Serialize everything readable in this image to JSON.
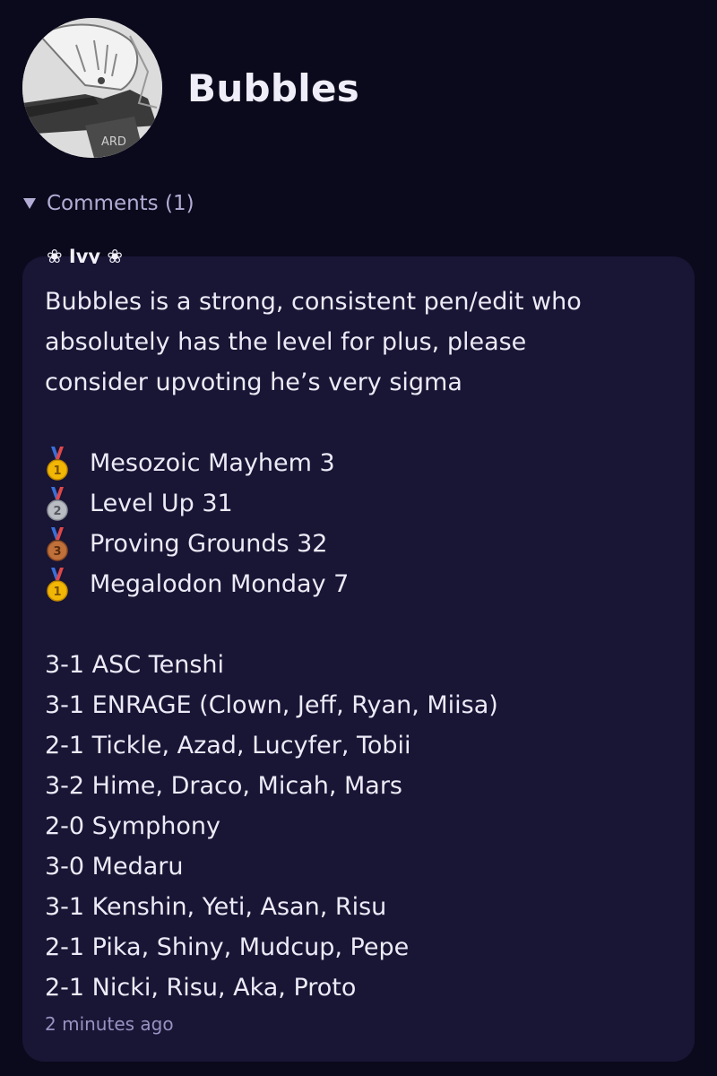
{
  "profile": {
    "username": "Bubbles",
    "avatar_text": "ARD"
  },
  "comments": {
    "toggle_label": "Comments (1)",
    "items": [
      {
        "author": "❀ Ivy ❀",
        "intro_lines": [
          "Bubbles is a strong, consistent pen/edit who",
          "absolutely has the level for plus, please",
          "consider upvoting he’s very sigma"
        ],
        "placements": [
          {
            "medal": "gold-medal-icon",
            "place": "1",
            "event": "Mesozoic Mayhem 3"
          },
          {
            "medal": "silver-medal-icon",
            "place": "2",
            "event": "Level Up 31"
          },
          {
            "medal": "bronze-medal-icon",
            "place": "3",
            "event": "Proving Grounds 32"
          },
          {
            "medal": "gold-medal-icon",
            "place": "1",
            "event": "Megalodon Monday 7"
          }
        ],
        "results": [
          "3-1 ASC Tenshi",
          "3-1 ENRAGE (Clown, Jeff, Ryan, Miisa)",
          "2-1 Tickle, Azad, Lucyfer, Tobii",
          "3-2 Hime, Draco, Micah, Mars",
          "2-0 Symphony",
          "3-0 Medaru",
          "3-1 Kenshin, Yeti, Asan, Risu",
          "2-1 Pika, Shiny, Mudcup, Pepe",
          "2-1 Nicki, Risu, Aka, Proto"
        ],
        "timestamp": "2 minutes ago"
      }
    ]
  },
  "colors": {
    "background": "#0b0a1c",
    "card": "#181535",
    "accent_text": "#b3add6",
    "gold": "#f2b705",
    "silver": "#b9bcc2",
    "bronze": "#c0703a"
  }
}
